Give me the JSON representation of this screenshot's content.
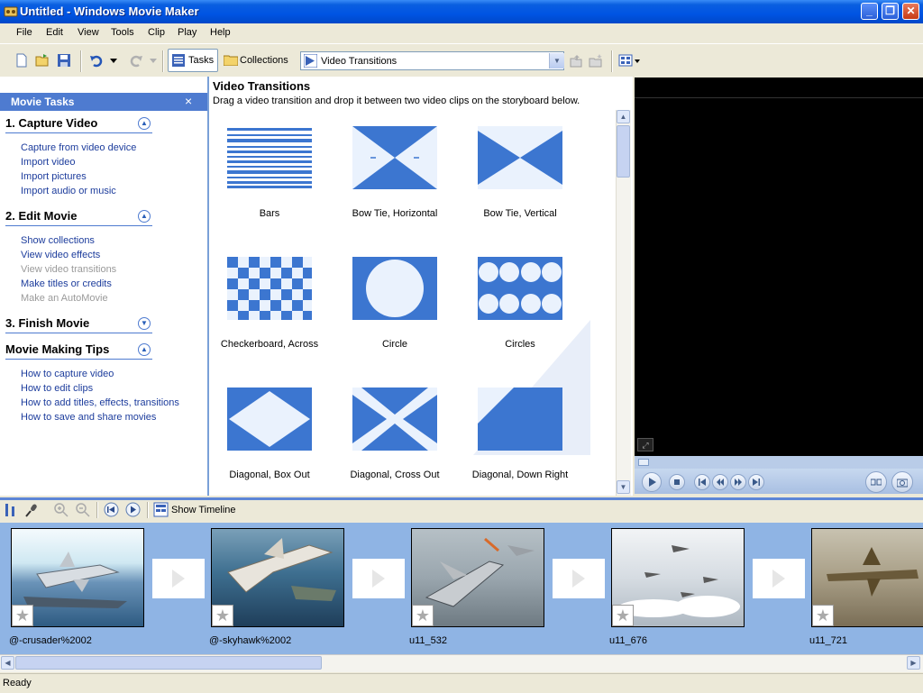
{
  "window": {
    "title": "Untitled - Windows Movie Maker",
    "minimize": "_",
    "maximize": "❐",
    "close": "✕"
  },
  "menu": [
    "File",
    "Edit",
    "View",
    "Tools",
    "Clip",
    "Play",
    "Help"
  ],
  "toolbar": {
    "tasks_label": "Tasks",
    "collections_label": "Collections",
    "location": "Video Transitions"
  },
  "taskpane": {
    "header": "Movie Tasks",
    "close": "×",
    "sections": [
      {
        "title": "1. Capture Video",
        "items": [
          "Capture from video device",
          "Import video",
          "Import pictures",
          "Import audio or music"
        ]
      },
      {
        "title": "2. Edit Movie",
        "items": [
          "Show collections",
          "View video effects",
          "View video transitions",
          "Make titles or credits",
          "Make an AutoMovie"
        ]
      },
      {
        "title": "3. Finish Movie",
        "items": []
      },
      {
        "title": "Movie Making Tips",
        "items": [
          "How to capture video",
          "How to edit clips",
          "How to add titles, effects, transitions",
          "How to save and share movies"
        ]
      }
    ]
  },
  "content": {
    "title": "Video Transitions",
    "description": "Drag a video transition and drop it between two video clips on the storyboard below.",
    "transitions": [
      "Bars",
      "Bow Tie, Horizontal",
      "Bow Tie, Vertical",
      "Checkerboard, Across",
      "Circle",
      "Circles",
      "Diagonal, Box Out",
      "Diagonal, Cross Out",
      "Diagonal, Down Right"
    ]
  },
  "storyboard_toolbar": {
    "show_timeline": "Show Timeline"
  },
  "storyboard": {
    "clips": [
      "@-crusader%2002",
      "@-skyhawk%2002",
      "u11_532",
      "u11_676",
      "u11_721"
    ]
  },
  "status": {
    "text": "Ready"
  },
  "colors": {
    "accent": "#4e7bd0",
    "link": "#1c3c9c",
    "storyboard": "#8fb4e4"
  }
}
